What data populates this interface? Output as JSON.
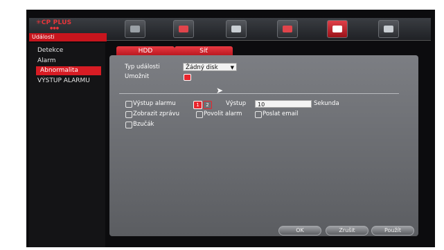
{
  "app": {
    "logo": "CP PLUS",
    "section_title": "Události"
  },
  "toolbar": {
    "icons": [
      "camera-icon",
      "display-icon",
      "record-icon",
      "storage-icon",
      "events-icon",
      "system-icon"
    ],
    "active_index": 4
  },
  "sidebar": {
    "items": [
      {
        "label": "Detekce"
      },
      {
        "label": "Alarm"
      },
      {
        "label": "Abnormalita"
      },
      {
        "label": "VÝSTUP ALARMU"
      }
    ]
  },
  "tabs": [
    {
      "label": "HDD"
    },
    {
      "label": "Síť"
    }
  ],
  "form": {
    "event_type_label": "Typ události",
    "event_type_value": "Žádný disk",
    "enable_label": "Umožnit",
    "alarm_output_label": "Výstup alarmu",
    "alarm_output_1": "1",
    "alarm_output_2": "2",
    "output_label": "Výstup",
    "output_value": "10",
    "output_unit": "Sekunda",
    "show_message_label": "Zobrazit zprávu",
    "enable_alarm_label": "Povolit alarm",
    "send_email_label": "Poslat email",
    "buzzer_label": "Bzučák"
  },
  "buttons": {
    "ok": "OK",
    "cancel": "Zrušit",
    "apply": "Použít"
  },
  "colors": {
    "accent": "#d71c24",
    "panel": "#6b6d71",
    "background": "#0c0c0e"
  }
}
